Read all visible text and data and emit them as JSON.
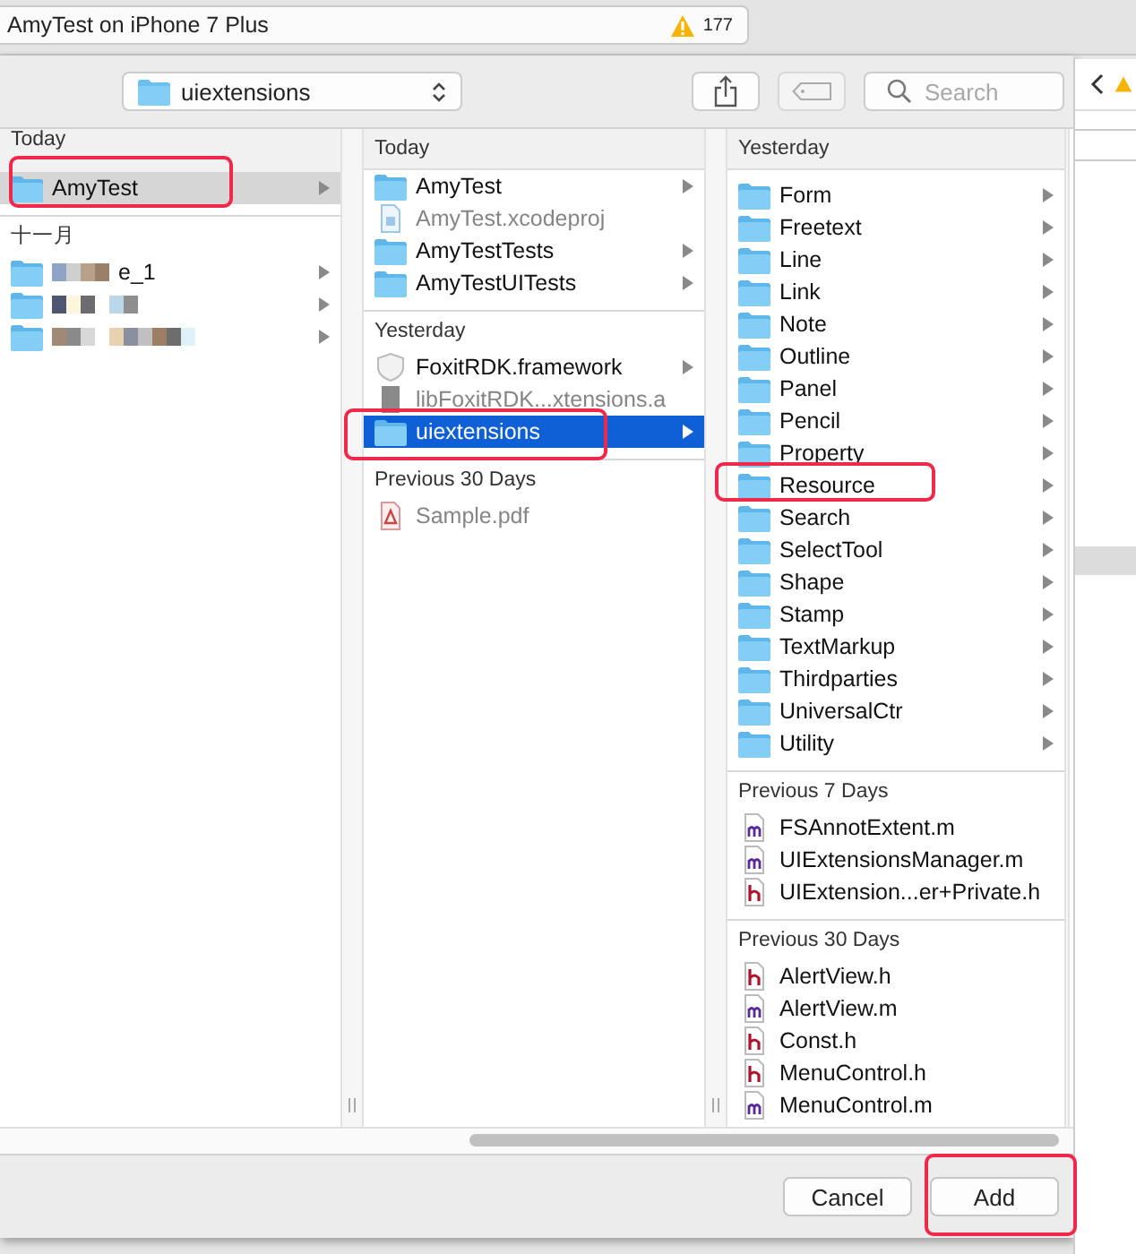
{
  "tab": {
    "title": "AmyTest on iPhone 7 Plus",
    "warnings": "177"
  },
  "toolbar": {
    "path": "uiextensions",
    "search": {
      "placeholder": "Search"
    }
  },
  "columns": [
    {
      "sections": [
        {
          "heading": "Today",
          "items": [
            {
              "name": "AmyTest",
              "kind": "folder",
              "dimmed": false,
              "has_children": true,
              "selected": true,
              "focus": false
            }
          ]
        },
        {
          "heading": "十一月",
          "items": [
            {
              "name": "e_1",
              "kind": "folder",
              "dimmed": false,
              "has_children": true,
              "selected": false,
              "blurred": true
            },
            {
              "kind": "folder",
              "has_children": true,
              "selected": false,
              "blurred": true
            },
            {
              "kind": "folder",
              "has_children": true,
              "selected": false,
              "blurred": true
            }
          ]
        }
      ]
    },
    {
      "sections": [
        {
          "heading": "Today",
          "items": [
            {
              "name": "AmyTest",
              "kind": "folder",
              "dimmed": false,
              "has_children": true,
              "selected": false
            },
            {
              "name": "AmyTest.xcodeproj",
              "kind": "project",
              "dimmed": true,
              "has_children": false,
              "selected": false
            },
            {
              "name": "AmyTestTests",
              "kind": "folder",
              "dimmed": false,
              "has_children": true,
              "selected": false
            },
            {
              "name": "AmyTestUITests",
              "kind": "folder",
              "dimmed": false,
              "has_children": true,
              "selected": false
            }
          ]
        },
        {
          "heading": "Yesterday",
          "items": [
            {
              "name": "FoxitRDK.framework",
              "kind": "framework",
              "dimmed": false,
              "has_children": true,
              "selected": false
            },
            {
              "name": "libFoxitRDK...xtensions.a",
              "kind": "library",
              "dimmed": true,
              "has_children": false,
              "selected": false
            },
            {
              "name": "uiextensions",
              "kind": "folder",
              "dimmed": false,
              "has_children": true,
              "selected": true,
              "focus": true
            }
          ]
        },
        {
          "heading": "Previous 30 Days",
          "items": [
            {
              "name": "Sample.pdf",
              "kind": "pdf",
              "dimmed": true,
              "has_children": false,
              "selected": false
            }
          ]
        }
      ]
    },
    {
      "sections": [
        {
          "heading": "Yesterday",
          "items": [
            {
              "name": "Form",
              "kind": "folder",
              "dimmed": false,
              "has_children": true,
              "selected": false
            },
            {
              "name": "Freetext",
              "kind": "folder",
              "dimmed": false,
              "has_children": true,
              "selected": false
            },
            {
              "name": "Line",
              "kind": "folder",
              "dimmed": false,
              "has_children": true,
              "selected": false
            },
            {
              "name": "Link",
              "kind": "folder",
              "dimmed": false,
              "has_children": true,
              "selected": false
            },
            {
              "name": "Note",
              "kind": "folder",
              "dimmed": false,
              "has_children": true,
              "selected": false
            },
            {
              "name": "Outline",
              "kind": "folder",
              "dimmed": false,
              "has_children": true,
              "selected": false
            },
            {
              "name": "Panel",
              "kind": "folder",
              "dimmed": false,
              "has_children": true,
              "selected": false
            },
            {
              "name": "Pencil",
              "kind": "folder",
              "dimmed": false,
              "has_children": true,
              "selected": false
            },
            {
              "name": "Property",
              "kind": "folder",
              "dimmed": false,
              "has_children": true,
              "selected": false
            },
            {
              "name": "Resource",
              "kind": "folder",
              "dimmed": false,
              "has_children": true,
              "selected": false
            },
            {
              "name": "Search",
              "kind": "folder",
              "dimmed": false,
              "has_children": true,
              "selected": false
            },
            {
              "name": "SelectTool",
              "kind": "folder",
              "dimmed": false,
              "has_children": true,
              "selected": false
            },
            {
              "name": "Shape",
              "kind": "folder",
              "dimmed": false,
              "has_children": true,
              "selected": false
            },
            {
              "name": "Stamp",
              "kind": "folder",
              "dimmed": false,
              "has_children": true,
              "selected": false
            },
            {
              "name": "TextMarkup",
              "kind": "folder",
              "dimmed": false,
              "has_children": true,
              "selected": false
            },
            {
              "name": "Thirdparties",
              "kind": "folder",
              "dimmed": false,
              "has_children": true,
              "selected": false
            },
            {
              "name": "UniversalCtr",
              "kind": "folder",
              "dimmed": false,
              "has_children": true,
              "selected": false
            },
            {
              "name": "Utility",
              "kind": "folder",
              "dimmed": false,
              "has_children": true,
              "selected": false
            }
          ]
        },
        {
          "heading": "Previous 7 Days",
          "items": [
            {
              "name": "FSAnnotExtent.m",
              "kind": "m",
              "dimmed": false,
              "has_children": false,
              "selected": false
            },
            {
              "name": "UIExtensionsManager.m",
              "kind": "m",
              "dimmed": false,
              "has_children": false,
              "selected": false
            },
            {
              "name": "UIExtension...er+Private.h",
              "kind": "h",
              "dimmed": false,
              "has_children": false,
              "selected": false
            }
          ]
        },
        {
          "heading": "Previous 30 Days",
          "items": [
            {
              "name": "AlertView.h",
              "kind": "h",
              "dimmed": false,
              "has_children": false,
              "selected": false
            },
            {
              "name": "AlertView.m",
              "kind": "m",
              "dimmed": false,
              "has_children": false,
              "selected": false
            },
            {
              "name": "Const.h",
              "kind": "h",
              "dimmed": false,
              "has_children": false,
              "selected": false
            },
            {
              "name": "MenuControl.h",
              "kind": "h",
              "dimmed": false,
              "has_children": false,
              "selected": false
            },
            {
              "name": "MenuControl.m",
              "kind": "m",
              "dimmed": false,
              "has_children": false,
              "selected": false
            }
          ]
        }
      ]
    }
  ],
  "buttons": [
    {
      "label": "Cancel"
    },
    {
      "label": "Add"
    }
  ]
}
